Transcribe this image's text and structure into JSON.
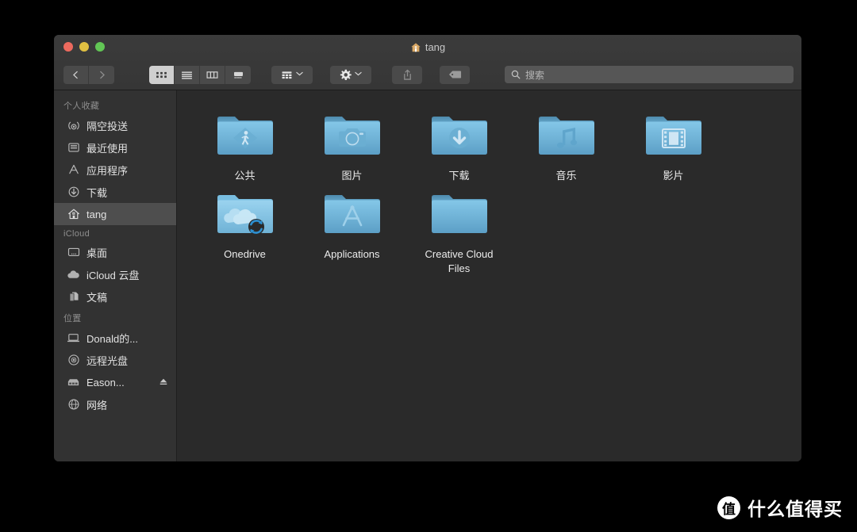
{
  "window": {
    "title": "tang",
    "title_icon": "home-icon",
    "traffic_lights": [
      {
        "name": "close-button",
        "color": "#ed6a5e"
      },
      {
        "name": "minimize-button",
        "color": "#e0c042"
      },
      {
        "name": "maximize-button",
        "color": "#62c655"
      }
    ]
  },
  "toolbar": {
    "back_label": "‹",
    "forward_label": "›",
    "view_modes": [
      {
        "name": "icon-view",
        "icon": "grid-icon",
        "active": true
      },
      {
        "name": "list-view",
        "icon": "list-icon",
        "active": false
      },
      {
        "name": "column-view",
        "icon": "columns-icon",
        "active": false
      },
      {
        "name": "gallery-view",
        "icon": "coverflow-icon",
        "active": false
      }
    ],
    "arrange_button": {
      "name": "arrange-button",
      "icon": "arrange-grid-icon"
    },
    "action_button": {
      "name": "action-button",
      "icon": "gear-icon"
    },
    "share_button": {
      "name": "share-button",
      "icon": "share-icon"
    },
    "tag_button": {
      "name": "tag-button",
      "icon": "tag-icon"
    },
    "chevron": "˅"
  },
  "search": {
    "placeholder": "搜索",
    "value": "",
    "icon": "search-icon"
  },
  "sidebar": {
    "sections": [
      {
        "header": "个人收藏",
        "items": [
          {
            "label": "隔空投送",
            "icon": "airdrop-icon",
            "selected": false,
            "eject": false
          },
          {
            "label": "最近使用",
            "icon": "recents-icon",
            "selected": false,
            "eject": false
          },
          {
            "label": "应用程序",
            "icon": "applications-icon",
            "selected": false,
            "eject": false
          },
          {
            "label": "下载",
            "icon": "downloads-icon",
            "selected": false,
            "eject": false
          },
          {
            "label": "tang",
            "icon": "home-icon",
            "selected": true,
            "eject": false
          }
        ]
      },
      {
        "header": "iCloud",
        "items": [
          {
            "label": "桌面",
            "icon": "desktop-icon",
            "selected": false,
            "eject": false
          },
          {
            "label": "iCloud 云盘",
            "icon": "cloud-icon",
            "selected": false,
            "eject": false
          },
          {
            "label": "文稿",
            "icon": "documents-icon",
            "selected": false,
            "eject": false
          }
        ]
      },
      {
        "header": "位置",
        "items": [
          {
            "label": "Donald的...",
            "icon": "laptop-icon",
            "selected": false,
            "eject": false
          },
          {
            "label": "远程光盘",
            "icon": "disc-icon",
            "selected": false,
            "eject": false
          },
          {
            "label": "Eason...",
            "icon": "server-icon",
            "selected": false,
            "eject": true
          },
          {
            "label": "网络",
            "icon": "network-icon",
            "selected": false,
            "eject": false
          }
        ]
      }
    ],
    "eject_glyph": "⏏"
  },
  "main": {
    "files": [
      {
        "label": "公共",
        "icon": "folder-public-icon"
      },
      {
        "label": "图片",
        "icon": "folder-pictures-icon"
      },
      {
        "label": "下载",
        "icon": "folder-downloads-icon"
      },
      {
        "label": "音乐",
        "icon": "folder-music-icon"
      },
      {
        "label": "影片",
        "icon": "folder-movies-icon"
      },
      {
        "label": "Onedrive",
        "icon": "folder-onedrive-icon"
      },
      {
        "label": "Applications",
        "icon": "folder-applications-icon"
      },
      {
        "label": "Creative Cloud Files",
        "icon": "folder-plain-icon"
      }
    ]
  },
  "watermark": {
    "logo": "值",
    "text": "什么值得买"
  },
  "colors": {
    "window_bg": "#2a2a2a",
    "sidebar_bg": "#323232",
    "titlebar_bg": "#3b3b3b",
    "selection_bg": "#4e4e4e",
    "folder_blue": "#6cb6dc"
  }
}
